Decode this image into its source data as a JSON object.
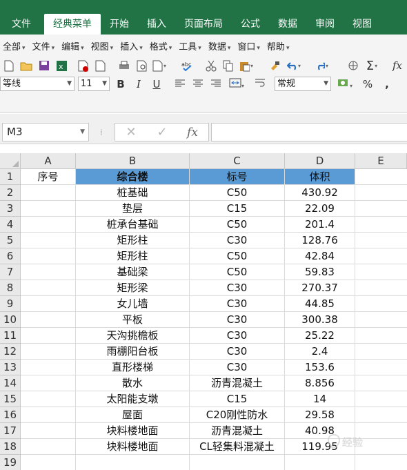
{
  "ribbon": {
    "tabs": [
      {
        "label": "文件",
        "active": false
      },
      {
        "label": "经典菜单",
        "active": true
      },
      {
        "label": "开始",
        "active": false
      },
      {
        "label": "插入",
        "active": false
      },
      {
        "label": "页面布局",
        "active": false
      },
      {
        "label": "公式",
        "active": false
      },
      {
        "label": "数据",
        "active": false
      },
      {
        "label": "审阅",
        "active": false
      },
      {
        "label": "视图",
        "active": false
      }
    ],
    "accent_color": "#217346"
  },
  "menus": [
    "全部",
    "文件",
    "编辑",
    "视图",
    "插入",
    "格式",
    "工具",
    "数据",
    "窗口",
    "帮助"
  ],
  "format": {
    "font_name": "等线",
    "font_size": "11",
    "number_format": "常规",
    "bold": "B",
    "italic": "I",
    "underline": "U",
    "percent": "%"
  },
  "formula_bar": {
    "name_box": "M3",
    "cancel_icon": "✕",
    "enter_icon": "✓",
    "fx_label": "fx",
    "formula": ""
  },
  "sheet": {
    "columns": [
      "A",
      "B",
      "C",
      "D",
      "E"
    ],
    "rows": [
      "1",
      "2",
      "3",
      "4",
      "5",
      "6",
      "7",
      "8",
      "9",
      "10",
      "11",
      "12",
      "13",
      "14",
      "15",
      "16",
      "17",
      "18",
      "19"
    ],
    "header_row": {
      "a": "序号",
      "b": "综合楼",
      "c": "标号",
      "d": "体积"
    },
    "header_fill": "#5b9bd5",
    "data": [
      {
        "b": "桩基础",
        "c": "C50",
        "d": "430.92"
      },
      {
        "b": "垫层",
        "c": "C15",
        "d": "22.09"
      },
      {
        "b": "桩承台基础",
        "c": "C50",
        "d": "201.4"
      },
      {
        "b": "矩形柱",
        "c": "C30",
        "d": "128.76"
      },
      {
        "b": "矩形柱",
        "c": "C50",
        "d": "42.84"
      },
      {
        "b": "基础梁",
        "c": "C50",
        "d": "59.83"
      },
      {
        "b": "矩形梁",
        "c": "C30",
        "d": "270.37"
      },
      {
        "b": "女儿墙",
        "c": "C30",
        "d": "44.85"
      },
      {
        "b": "平板",
        "c": "C30",
        "d": "300.38"
      },
      {
        "b": "天沟挑檐板",
        "c": "C30",
        "d": "25.22"
      },
      {
        "b": "雨棚阳台板",
        "c": "C30",
        "d": "2.4"
      },
      {
        "b": "直形楼梯",
        "c": "C30",
        "d": "153.6"
      },
      {
        "b": "散水",
        "c": "沥青混凝土",
        "d": "8.856"
      },
      {
        "b": "太阳能支墩",
        "c": "C15",
        "d": "14"
      },
      {
        "b": "屋面",
        "c": "C20刚性防水",
        "d": "29.58"
      },
      {
        "b": "块料楼地面",
        "c": "沥青混凝土",
        "d": "40.98"
      },
      {
        "b": "块料楼地面",
        "c": "CL轻集料混凝土",
        "d": "119.95"
      }
    ]
  },
  "watermark": "经验"
}
